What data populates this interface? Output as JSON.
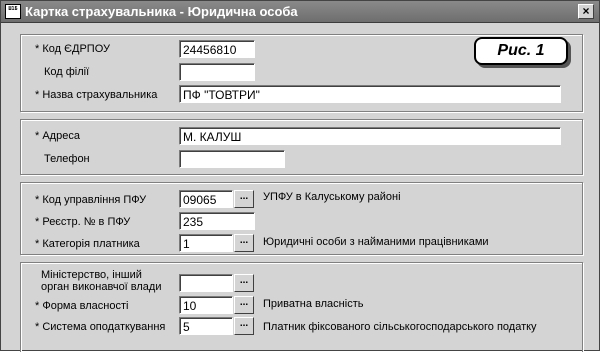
{
  "window": {
    "icon_text": "Ш1Б",
    "title": "Картка страхувальника - Юридична особа",
    "close_label": "×"
  },
  "badge": {
    "label": "Рис. 1"
  },
  "section1": {
    "edrpou_label": "* Код ЄДРПОУ",
    "edrpou_value": "24456810",
    "branch_label": "Код філії",
    "branch_value": "",
    "name_label": "* Назва страхувальника",
    "name_value": "ПФ \"ТОВТРИ\""
  },
  "section2": {
    "address_label": "* Адреса",
    "address_value": "М. КАЛУШ",
    "phone_label": "Телефон",
    "phone_value": ""
  },
  "section3": {
    "pfu_code_label": "* Код управління ПФУ",
    "pfu_code_value": "09065",
    "pfu_code_desc": "УПФУ в Калуському районі",
    "reg_no_label": "* Реєстр. № в ПФУ",
    "reg_no_value": "235",
    "category_label": "* Категорія платника",
    "category_value": "1",
    "category_desc": "Юридичні особи з найманими працівниками"
  },
  "section4": {
    "ministry_label": "Міністерство, інший орган виконавчої влади",
    "ministry_value": "",
    "ownership_label": "* Форма власності",
    "ownership_value": "10",
    "ownership_desc": "Приватна власність",
    "tax_label": "* Система оподаткування",
    "tax_value": "5",
    "tax_desc": "Платник фіксованого сільськогосподарського податку"
  },
  "lookup_button_label": "..."
}
